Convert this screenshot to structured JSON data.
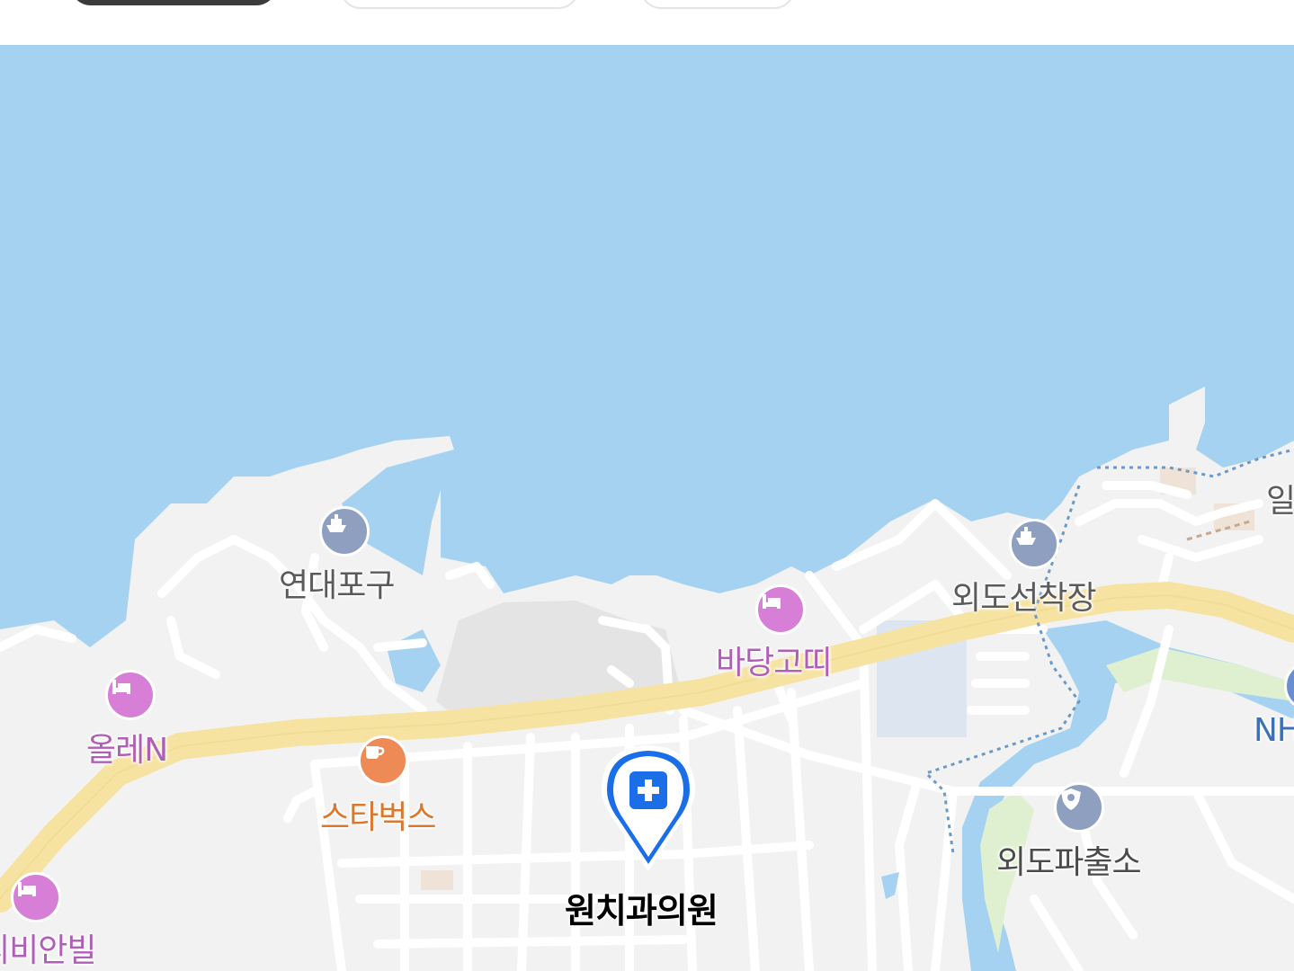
{
  "top_chips": [
    "",
    "",
    ""
  ],
  "map": {
    "colors": {
      "sea": "#a5d2f0",
      "land": "#f2f2f2",
      "road_main": "#f7e3a1",
      "road_minor": "#ffffff",
      "park": "#dff0d0",
      "selected_pin": "#1a6fe8"
    },
    "places": {
      "yeondae_port": "연대포구",
      "oedo_dock": "외도선착장",
      "badang_goddi": "바당고띠",
      "olle_n": "올레N",
      "starbucks": "스타벅스",
      "oedo_police": "외도파출소",
      "ribian_vil": "리비안빌",
      "nh_partial": "NH",
      "partial_right_top": "일"
    },
    "selected_place": {
      "name": "원치과의원",
      "category_icon": "hospital-cross-icon"
    },
    "poi_icons": {
      "ferry": "ferry-icon",
      "hotel": "bed-icon",
      "cafe": "coffee-cup-icon",
      "police": "police-badge-icon",
      "bank": "bank-icon"
    }
  }
}
